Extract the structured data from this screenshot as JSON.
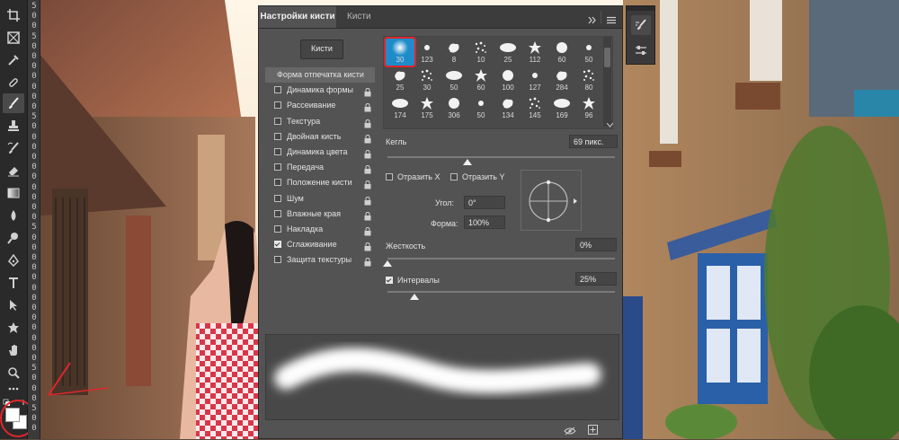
{
  "toolbar": {
    "tools": [
      {
        "icon": "crop-icon"
      },
      {
        "icon": "frame-icon"
      },
      {
        "icon": "eyedropper-icon"
      },
      {
        "icon": "healing-brush-icon"
      },
      {
        "icon": "brush-icon"
      },
      {
        "icon": "clone-stamp-icon"
      },
      {
        "icon": "history-brush-icon"
      },
      {
        "icon": "eraser-icon"
      },
      {
        "icon": "gradient-icon"
      },
      {
        "icon": "blur-icon"
      },
      {
        "icon": "dodge-icon"
      },
      {
        "icon": "pen-icon"
      },
      {
        "icon": "type-icon"
      },
      {
        "icon": "path-selection-icon"
      },
      {
        "icon": "custom-shape-icon"
      },
      {
        "icon": "hand-icon"
      },
      {
        "icon": "zoom-icon"
      },
      {
        "icon": "more-tools-icon"
      }
    ],
    "active_tool": "brush-icon",
    "foreground_color": "#ffffff",
    "background_color": "#ffffff"
  },
  "ruler": {
    "digits": [
      "5",
      "0",
      "0",
      "5",
      "0",
      "0",
      "0",
      "0",
      "0",
      "0",
      "0",
      "5",
      "0",
      "0",
      "0",
      "0",
      "0",
      "0",
      "0",
      "0",
      "0",
      "0",
      "5",
      "0",
      "0",
      "0",
      "0",
      "0",
      "0",
      "0",
      "0",
      "0",
      "0",
      "0",
      "0",
      "0",
      "5",
      "0",
      "0",
      "0",
      "5",
      "0",
      "0"
    ]
  },
  "panel": {
    "tabs": [
      {
        "label": "Настройки кисти"
      },
      {
        "label": "Кисти"
      }
    ],
    "brushes_button": "Кисти",
    "sections": [
      {
        "label": "Форма отпечатка кисти",
        "checkbox": false,
        "checked": false,
        "lock": false,
        "selected": true
      },
      {
        "label": "Динамика формы",
        "checkbox": true,
        "checked": false,
        "lock": true
      },
      {
        "label": "Рассеивание",
        "checkbox": true,
        "checked": false,
        "lock": true
      },
      {
        "label": "Текстура",
        "checkbox": true,
        "checked": false,
        "lock": true
      },
      {
        "label": "Двойная кисть",
        "checkbox": true,
        "checked": false,
        "lock": true
      },
      {
        "label": "Динамика цвета",
        "checkbox": true,
        "checked": false,
        "lock": true
      },
      {
        "label": "Передача",
        "checkbox": true,
        "checked": false,
        "lock": true
      },
      {
        "label": "Положение кисти",
        "checkbox": true,
        "checked": false,
        "lock": true
      },
      {
        "label": "Шум",
        "checkbox": true,
        "checked": false,
        "lock": true
      },
      {
        "label": "Влажные края",
        "checkbox": true,
        "checked": false,
        "lock": true
      },
      {
        "label": "Накладка",
        "checkbox": true,
        "checked": false,
        "lock": true
      },
      {
        "label": "Сглаживание",
        "checkbox": true,
        "checked": true,
        "lock": true
      },
      {
        "label": "Защита текстуры",
        "checkbox": true,
        "checked": false,
        "lock": true
      }
    ],
    "presets": [
      [
        "30",
        "123",
        "8",
        "10",
        "25",
        "112",
        "60",
        "50"
      ],
      [
        "25",
        "30",
        "50",
        "60",
        "100",
        "127",
        "284",
        "80"
      ],
      [
        "174",
        "175",
        "306",
        "50",
        "134",
        "145",
        "169",
        "96"
      ]
    ],
    "selected_preset": "30",
    "size_label": "Кегль",
    "size_value": "69 пикс.",
    "size_fraction": 0.35,
    "flip_x_label": "Отразить X",
    "flip_y_label": "Отразить Y",
    "angle_label": "Угол:",
    "angle_value": "0°",
    "roundness_label": "Форма:",
    "roundness_value": "100%",
    "hardness_label": "Жесткость",
    "hardness_value": "0%",
    "hardness_fraction": 0,
    "spacing_label": "Интервалы",
    "spacing_checked": true,
    "spacing_value": "25%",
    "spacing_fraction": 0.12
  },
  "side_panel": {
    "icons": [
      "brush-settings-icon",
      "adjust-icon"
    ]
  },
  "colors": {
    "panel": "#535353",
    "tab_bar": "#3c3c3c",
    "toolbar": "#2a2a2a",
    "highlight": "#e0262b"
  }
}
